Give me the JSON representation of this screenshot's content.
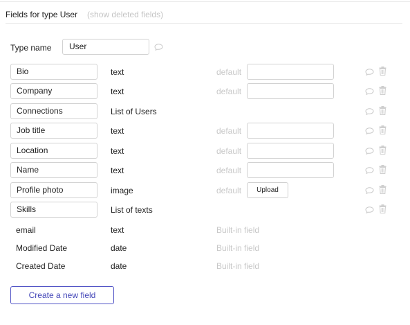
{
  "header": {
    "title": "Fields for type User",
    "toggle": "(show deleted fields)"
  },
  "type_name": {
    "label": "Type name",
    "value": "User"
  },
  "default_label": "default",
  "fields": [
    {
      "name": "Bio",
      "type": "text",
      "default_kind": "input"
    },
    {
      "name": "Company",
      "type": "text",
      "default_kind": "input"
    },
    {
      "name": "Connections",
      "type": "List of Users",
      "default_kind": "none"
    },
    {
      "name": "Job title",
      "type": "text",
      "default_kind": "input"
    },
    {
      "name": "Location",
      "type": "text",
      "default_kind": "input"
    },
    {
      "name": "Name",
      "type": "text",
      "default_kind": "input"
    },
    {
      "name": "Profile photo",
      "type": "image",
      "default_kind": "upload",
      "upload_label": "Upload"
    },
    {
      "name": "Skills",
      "type": "List of texts",
      "default_kind": "none"
    }
  ],
  "builtin_fields": [
    {
      "name": "email",
      "type": "text",
      "note": "Built-in field"
    },
    {
      "name": "Modified Date",
      "type": "date",
      "note": "Built-in field"
    },
    {
      "name": "Created Date",
      "type": "date",
      "note": "Built-in field"
    }
  ],
  "create_button": "Create a new field",
  "icons": {
    "comment": "speech-bubble-icon",
    "delete": "trash-icon"
  },
  "colors": {
    "accent": "#4346b8",
    "muted": "#c8c8c8",
    "border": "#d2d2d2"
  }
}
